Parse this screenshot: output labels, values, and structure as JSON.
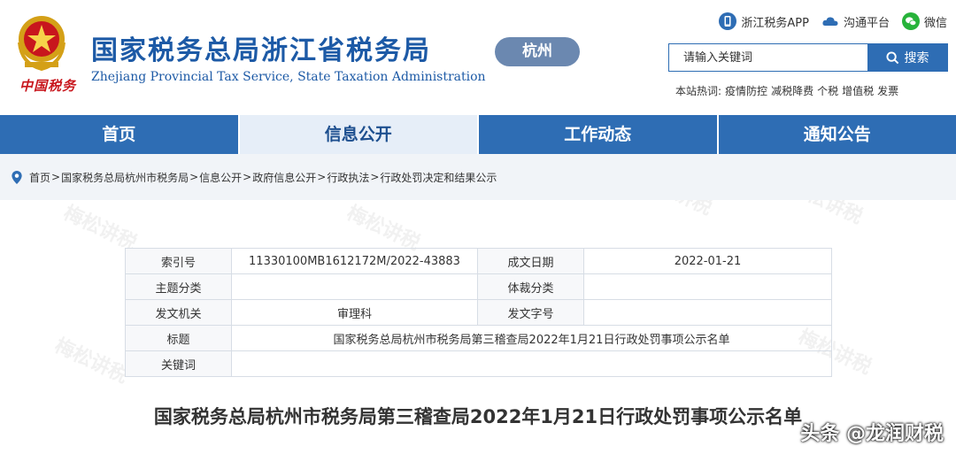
{
  "header": {
    "title": "国家税务总局浙江省税务局",
    "subtitle": "Zhejiang Provincial Tax Service, State Taxation Administration",
    "logo_text": "中国税务",
    "city_badge": "杭州",
    "top_links": [
      {
        "label": "浙江税务APP",
        "icon": "mobile-app-icon",
        "color": "#2e6db4"
      },
      {
        "label": "沟通平台",
        "icon": "cloud-icon",
        "color": "#2e6db4"
      },
      {
        "label": "微信",
        "icon": "wechat-icon",
        "color": "#27b33a"
      }
    ],
    "search": {
      "placeholder": "请输入关键词",
      "button_label": "搜索"
    },
    "hotwords_label": "本站热词:",
    "hotwords": [
      "疫情防控",
      "减税降费",
      "个税",
      "增值税",
      "发票"
    ]
  },
  "nav": {
    "items": [
      {
        "label": "首页"
      },
      {
        "label": "信息公开"
      },
      {
        "label": "工作动态"
      },
      {
        "label": "通知公告"
      }
    ],
    "active_index": 1
  },
  "breadcrumb": [
    "首页",
    "国家税务总局杭州市税务局",
    "信息公开",
    "政府信息公开",
    "行政执法",
    "行政处罚决定和结果公示"
  ],
  "meta": {
    "index_label": "索引号",
    "index_value": "11330100MB1612172M/2022-43883",
    "date_label": "成文日期",
    "date_value": "2022-01-21",
    "topic_label": "主题分类",
    "topic_value": "",
    "genre_label": "体裁分类",
    "genre_value": "",
    "issuer_label": "发文机关",
    "issuer_value": "审理科",
    "docno_label": "发文字号",
    "docno_value": "",
    "title_label": "标题",
    "title_value": "国家税务总局杭州市税务局第三稽查局2022年1月21日行政处罚事项公示名单",
    "keyword_label": "关键词",
    "keyword_value": ""
  },
  "document_title": "国家税务总局杭州市税务局第三稽查局2022年1月21日行政处罚事项公示名单",
  "watermark": "头条 @龙润财税",
  "faint_watermark": "梅松讲税",
  "colors": {
    "brand_blue": "#2e6db4",
    "title_blue": "#1d5aa6",
    "logo_red": "#c8161d"
  }
}
